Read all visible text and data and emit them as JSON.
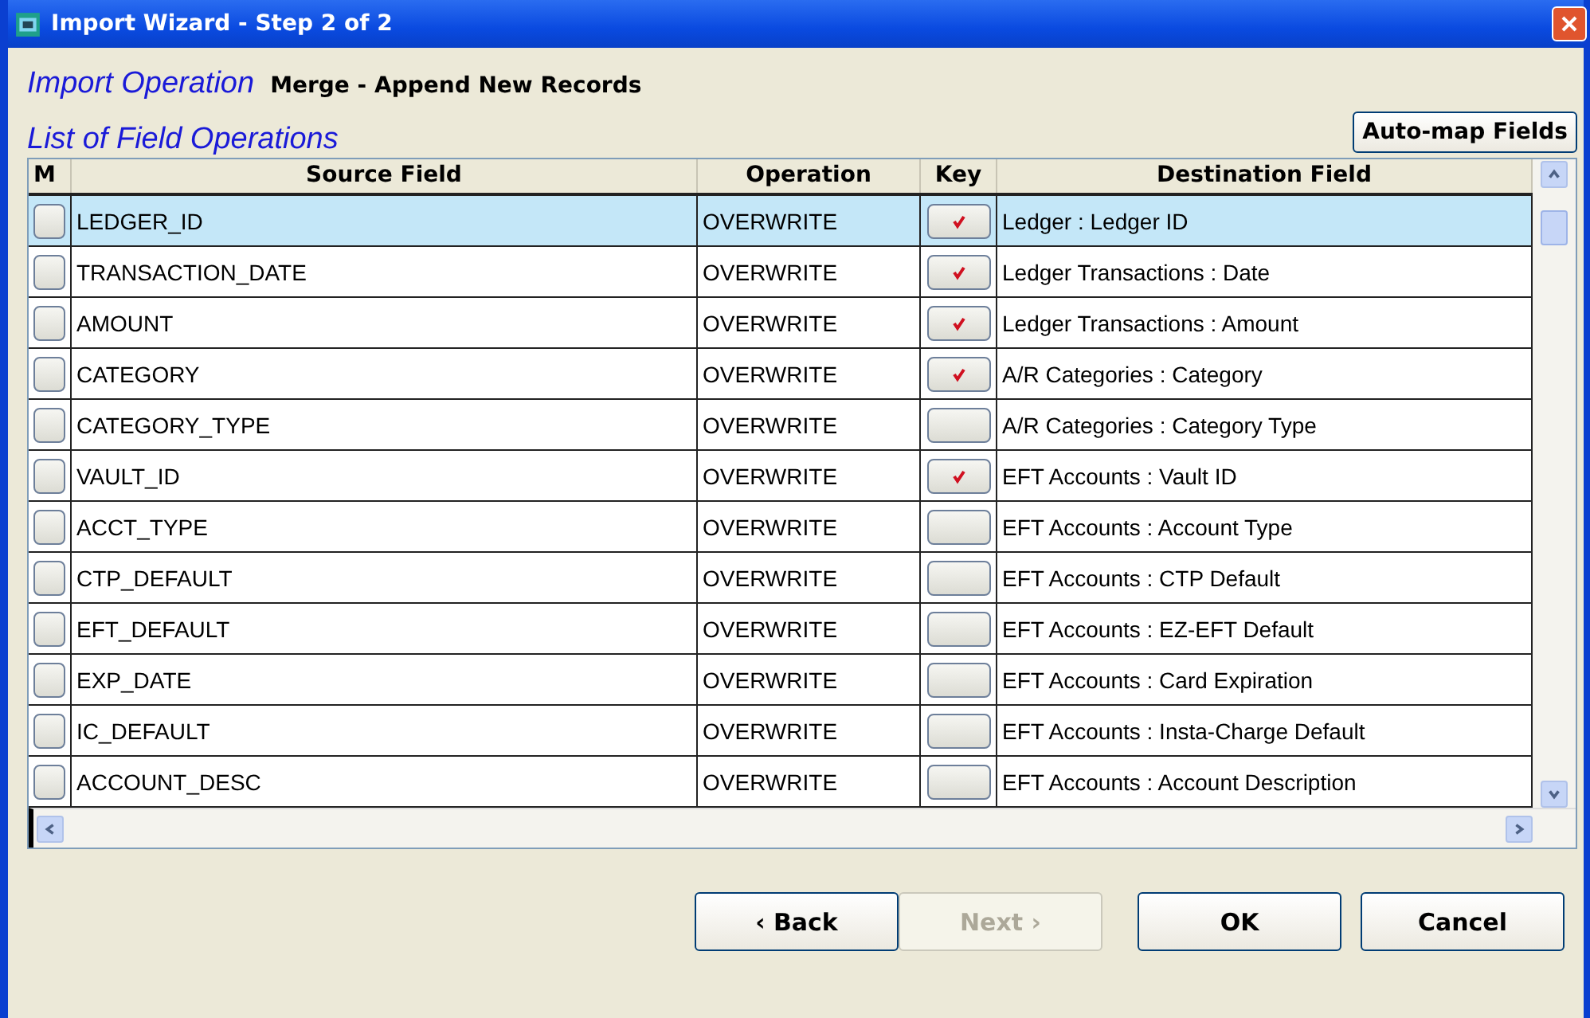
{
  "window": {
    "title": "Import Wizard - Step 2 of 2"
  },
  "import_operation": {
    "label": "Import Operation",
    "value": "Merge - Append New Records"
  },
  "list_heading": "List of Field Operations",
  "automap_button": "Auto-map Fields",
  "table": {
    "columns": [
      "M",
      "Source Field",
      "Operation",
      "Key",
      "Destination Field"
    ],
    "rows": [
      {
        "m": false,
        "source": "LEDGER_ID",
        "operation": "OVERWRITE",
        "key": true,
        "destination": "Ledger : Ledger ID",
        "selected": true
      },
      {
        "m": false,
        "source": "TRANSACTION_DATE",
        "operation": "OVERWRITE",
        "key": true,
        "destination": "Ledger Transactions : Date",
        "selected": false
      },
      {
        "m": false,
        "source": "AMOUNT",
        "operation": "OVERWRITE",
        "key": true,
        "destination": "Ledger Transactions : Amount",
        "selected": false
      },
      {
        "m": false,
        "source": "CATEGORY",
        "operation": "OVERWRITE",
        "key": true,
        "destination": "A/R Categories : Category",
        "selected": false
      },
      {
        "m": false,
        "source": "CATEGORY_TYPE",
        "operation": "OVERWRITE",
        "key": false,
        "destination": "A/R Categories : Category Type",
        "selected": false
      },
      {
        "m": false,
        "source": "VAULT_ID",
        "operation": "OVERWRITE",
        "key": true,
        "destination": "EFT Accounts : Vault ID",
        "selected": false
      },
      {
        "m": false,
        "source": "ACCT_TYPE",
        "operation": "OVERWRITE",
        "key": false,
        "destination": "EFT Accounts : Account Type",
        "selected": false
      },
      {
        "m": false,
        "source": "CTP_DEFAULT",
        "operation": "OVERWRITE",
        "key": false,
        "destination": "EFT Accounts : CTP Default",
        "selected": false
      },
      {
        "m": false,
        "source": "EFT_DEFAULT",
        "operation": "OVERWRITE",
        "key": false,
        "destination": "EFT Accounts : EZ-EFT Default",
        "selected": false
      },
      {
        "m": false,
        "source": "EXP_DATE",
        "operation": "OVERWRITE",
        "key": false,
        "destination": "EFT Accounts : Card Expiration",
        "selected": false
      },
      {
        "m": false,
        "source": "IC_DEFAULT",
        "operation": "OVERWRITE",
        "key": false,
        "destination": "EFT Accounts : Insta-Charge Default",
        "selected": false
      },
      {
        "m": false,
        "source": "ACCOUNT_DESC",
        "operation": "OVERWRITE",
        "key": false,
        "destination": "EFT Accounts : Account Description",
        "selected": false
      }
    ]
  },
  "buttons": [
    {
      "label": "‹ Back",
      "disabled": false
    },
    {
      "label": "Next ›",
      "disabled": true
    },
    {
      "label": "OK",
      "disabled": false
    },
    {
      "label": "Cancel",
      "disabled": false
    }
  ]
}
